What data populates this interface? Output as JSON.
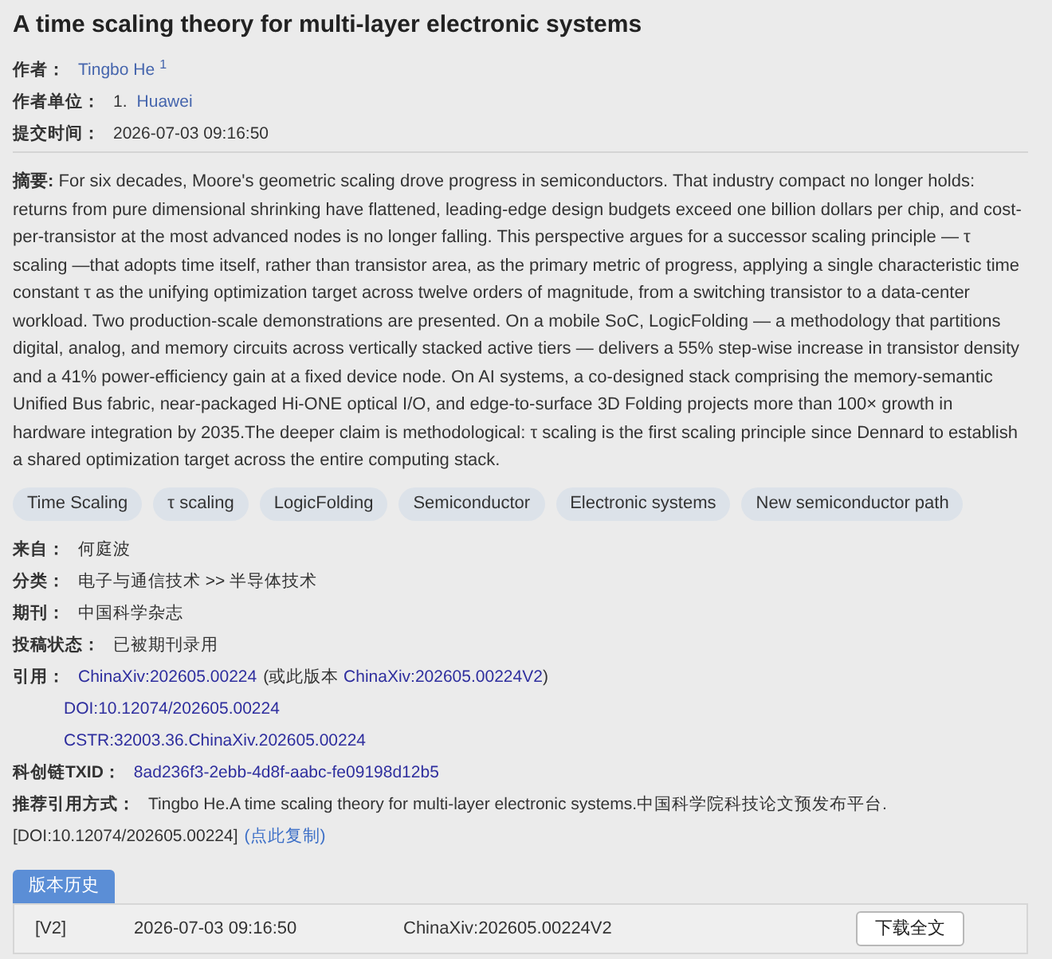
{
  "title": "A time scaling theory for multi-layer electronic systems",
  "header": {
    "authors": {
      "label": "作者：",
      "items": [
        {
          "name": "Tingbo He",
          "mark": "1"
        }
      ]
    },
    "affiliations": {
      "label": "作者单位：",
      "items": [
        {
          "index": "1.",
          "name": "Huawei"
        }
      ]
    },
    "submitted": {
      "label": "提交时间：",
      "value": "2026-07-03 09:16:50"
    }
  },
  "abstract": {
    "text": "**摘要:** For six decades, Moore's geometric scaling drove progress in semiconductors. That industry compact no longer holds: returns from pure dimensional shrinking have flattened, leading-edge design budgets exceed one billion dollars per chip, and cost-per-transistor at the most advanced nodes is no longer falling. This perspective argues for a successor scaling principle — τ scaling —that adopts time itself, rather than transistor area, as the primary metric of progress, applying a single characteristic time constant τ as the unifying optimization target across twelve orders of magnitude, from a switching transistor to a data-center workload. Two production-scale demonstrations are presented. On a mobile SoC, LogicFolding — a methodology that partitions digital, analog, and memory circuits across vertically stacked active tiers — delivers a 55% step-wise increase in transistor density and a 41% power-efficiency gain at a fixed device node. On AI systems, a co-designed stack comprising the memory-semantic Unified Bus fabric, near-packaged Hi-ONE optical I/O, and edge-to-surface 3D Folding projects more than 100× growth in hardware integration by 2035.The deeper claim is methodological: τ scaling is the first scaling principle since Dennard to establish a shared optimization target across the entire computing stack."
  },
  "keywords": [
    "Time Scaling",
    "τ scaling",
    "LogicFolding",
    "Semiconductor",
    "Electronic systems",
    "New semiconductor path"
  ],
  "info": [
    {
      "kind": "text",
      "label": "来自：",
      "value": "何庭波"
    },
    {
      "kind": "text",
      "label": "分类：",
      "value": "电子与通信技术 >> 半导体技术"
    },
    {
      "kind": "text",
      "label": "期刊：",
      "value": "中国科学杂志"
    },
    {
      "kind": "text",
      "label": "投稿状态：",
      "value": "已被期刊录用"
    },
    {
      "kind": "citation",
      "label": "引用：",
      "link": "ChinaXiv:202605.00224",
      "note_before": "(或此版本",
      "version_link": "ChinaXiv:202605.00224V2",
      "note_after": ")",
      "extra_links": [
        "DOI:10.12074/202605.00224",
        "CSTR:32003.36.ChinaXiv.202605.00224"
      ]
    },
    {
      "kind": "link",
      "label": "科创链TXID：",
      "value": "8ad236f3-2ebb-4d8f-aabc-fe09198d12b5"
    },
    {
      "kind": "recommend",
      "label": "推荐引用方式：",
      "value": "Tingbo He.A time scaling theory for multi-layer electronic systems.中国科学院科技论文预发布平台.",
      "doi": "[DOI:10.12074/202605.00224]",
      "copy_link": "(点此复制)"
    }
  ],
  "versions": {
    "tabs": [
      {
        "label": "版本历史",
        "selected": true
      }
    ],
    "rows": [
      {
        "version": "[V2]",
        "date": "2026-07-03 09:16:50",
        "id": "ChinaXiv:202605.00224V2",
        "action": "下载全文"
      }
    ]
  }
}
